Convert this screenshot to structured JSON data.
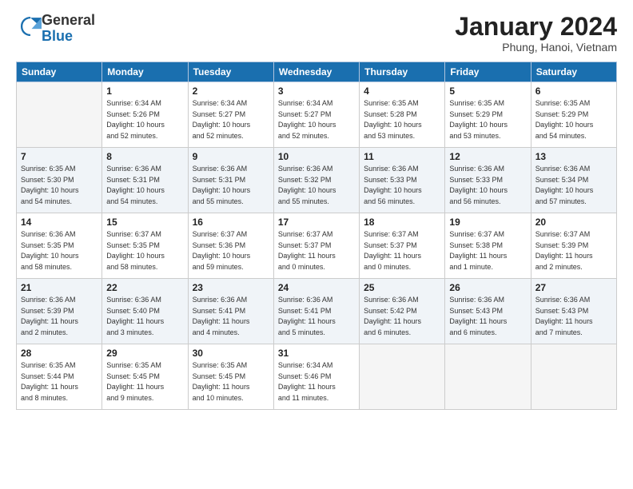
{
  "header": {
    "logo_general": "General",
    "logo_blue": "Blue",
    "month_title": "January 2024",
    "location": "Phung, Hanoi, Vietnam"
  },
  "weekdays": [
    "Sunday",
    "Monday",
    "Tuesday",
    "Wednesday",
    "Thursday",
    "Friday",
    "Saturday"
  ],
  "weeks": [
    [
      {
        "day": "",
        "info": ""
      },
      {
        "day": "1",
        "info": "Sunrise: 6:34 AM\nSunset: 5:26 PM\nDaylight: 10 hours\nand 52 minutes."
      },
      {
        "day": "2",
        "info": "Sunrise: 6:34 AM\nSunset: 5:27 PM\nDaylight: 10 hours\nand 52 minutes."
      },
      {
        "day": "3",
        "info": "Sunrise: 6:34 AM\nSunset: 5:27 PM\nDaylight: 10 hours\nand 52 minutes."
      },
      {
        "day": "4",
        "info": "Sunrise: 6:35 AM\nSunset: 5:28 PM\nDaylight: 10 hours\nand 53 minutes."
      },
      {
        "day": "5",
        "info": "Sunrise: 6:35 AM\nSunset: 5:29 PM\nDaylight: 10 hours\nand 53 minutes."
      },
      {
        "day": "6",
        "info": "Sunrise: 6:35 AM\nSunset: 5:29 PM\nDaylight: 10 hours\nand 54 minutes."
      }
    ],
    [
      {
        "day": "7",
        "info": "Sunrise: 6:35 AM\nSunset: 5:30 PM\nDaylight: 10 hours\nand 54 minutes."
      },
      {
        "day": "8",
        "info": "Sunrise: 6:36 AM\nSunset: 5:31 PM\nDaylight: 10 hours\nand 54 minutes."
      },
      {
        "day": "9",
        "info": "Sunrise: 6:36 AM\nSunset: 5:31 PM\nDaylight: 10 hours\nand 55 minutes."
      },
      {
        "day": "10",
        "info": "Sunrise: 6:36 AM\nSunset: 5:32 PM\nDaylight: 10 hours\nand 55 minutes."
      },
      {
        "day": "11",
        "info": "Sunrise: 6:36 AM\nSunset: 5:33 PM\nDaylight: 10 hours\nand 56 minutes."
      },
      {
        "day": "12",
        "info": "Sunrise: 6:36 AM\nSunset: 5:33 PM\nDaylight: 10 hours\nand 56 minutes."
      },
      {
        "day": "13",
        "info": "Sunrise: 6:36 AM\nSunset: 5:34 PM\nDaylight: 10 hours\nand 57 minutes."
      }
    ],
    [
      {
        "day": "14",
        "info": "Sunrise: 6:36 AM\nSunset: 5:35 PM\nDaylight: 10 hours\nand 58 minutes."
      },
      {
        "day": "15",
        "info": "Sunrise: 6:37 AM\nSunset: 5:35 PM\nDaylight: 10 hours\nand 58 minutes."
      },
      {
        "day": "16",
        "info": "Sunrise: 6:37 AM\nSunset: 5:36 PM\nDaylight: 10 hours\nand 59 minutes."
      },
      {
        "day": "17",
        "info": "Sunrise: 6:37 AM\nSunset: 5:37 PM\nDaylight: 11 hours\nand 0 minutes."
      },
      {
        "day": "18",
        "info": "Sunrise: 6:37 AM\nSunset: 5:37 PM\nDaylight: 11 hours\nand 0 minutes."
      },
      {
        "day": "19",
        "info": "Sunrise: 6:37 AM\nSunset: 5:38 PM\nDaylight: 11 hours\nand 1 minute."
      },
      {
        "day": "20",
        "info": "Sunrise: 6:37 AM\nSunset: 5:39 PM\nDaylight: 11 hours\nand 2 minutes."
      }
    ],
    [
      {
        "day": "21",
        "info": "Sunrise: 6:36 AM\nSunset: 5:39 PM\nDaylight: 11 hours\nand 2 minutes."
      },
      {
        "day": "22",
        "info": "Sunrise: 6:36 AM\nSunset: 5:40 PM\nDaylight: 11 hours\nand 3 minutes."
      },
      {
        "day": "23",
        "info": "Sunrise: 6:36 AM\nSunset: 5:41 PM\nDaylight: 11 hours\nand 4 minutes."
      },
      {
        "day": "24",
        "info": "Sunrise: 6:36 AM\nSunset: 5:41 PM\nDaylight: 11 hours\nand 5 minutes."
      },
      {
        "day": "25",
        "info": "Sunrise: 6:36 AM\nSunset: 5:42 PM\nDaylight: 11 hours\nand 6 minutes."
      },
      {
        "day": "26",
        "info": "Sunrise: 6:36 AM\nSunset: 5:43 PM\nDaylight: 11 hours\nand 6 minutes."
      },
      {
        "day": "27",
        "info": "Sunrise: 6:36 AM\nSunset: 5:43 PM\nDaylight: 11 hours\nand 7 minutes."
      }
    ],
    [
      {
        "day": "28",
        "info": "Sunrise: 6:35 AM\nSunset: 5:44 PM\nDaylight: 11 hours\nand 8 minutes."
      },
      {
        "day": "29",
        "info": "Sunrise: 6:35 AM\nSunset: 5:45 PM\nDaylight: 11 hours\nand 9 minutes."
      },
      {
        "day": "30",
        "info": "Sunrise: 6:35 AM\nSunset: 5:45 PM\nDaylight: 11 hours\nand 10 minutes."
      },
      {
        "day": "31",
        "info": "Sunrise: 6:34 AM\nSunset: 5:46 PM\nDaylight: 11 hours\nand 11 minutes."
      },
      {
        "day": "",
        "info": ""
      },
      {
        "day": "",
        "info": ""
      },
      {
        "day": "",
        "info": ""
      }
    ]
  ]
}
